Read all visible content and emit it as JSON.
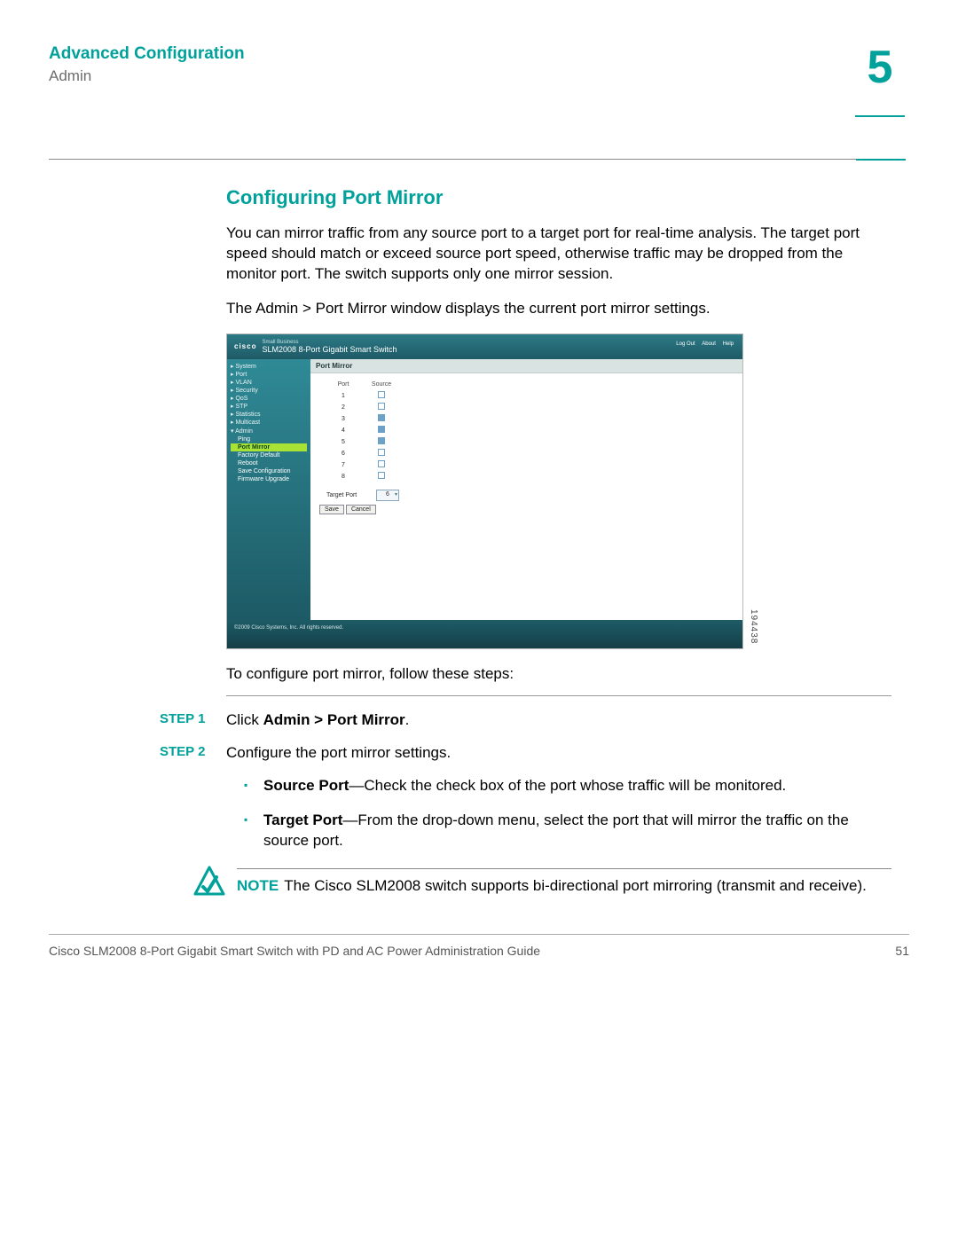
{
  "header": {
    "title": "Advanced Configuration",
    "breadcrumb": "Admin",
    "chapter_number": "5"
  },
  "section": {
    "title": "Configuring Port Mirror",
    "intro_1": "You can mirror traffic from any source port to a target port for real-time analysis. The target port speed should match or exceed source port speed, otherwise traffic may be dropped from the monitor port. The switch supports only one mirror session.",
    "intro_2": "The Admin > Port Mirror window displays the current port mirror settings."
  },
  "screenshot": {
    "logo": "cisco",
    "small_business": "Small Business",
    "product_name": "SLM2008 8-Port Gigabit Smart Switch",
    "top_links": [
      "Log Out",
      "About",
      "Help"
    ],
    "nav_items": [
      "▸ System",
      "▸ Port",
      "▸ VLAN",
      "▸ Security",
      "▸ QoS",
      "▸ STP",
      "▸ Statistics",
      "▸ Multicast"
    ],
    "nav_admin": "▾ Admin",
    "nav_sub_items_before": [
      "Ping"
    ],
    "nav_selected": "Port Mirror",
    "nav_sub_items_after": [
      "Factory Default",
      "Reboot",
      "Save Configuration",
      "Firmware Upgrade"
    ],
    "panel_title": "Port Mirror",
    "col_port": "Port",
    "col_source": "Source",
    "ports": [
      {
        "port": "1",
        "checked": false
      },
      {
        "port": "2",
        "checked": false
      },
      {
        "port": "3",
        "checked": true
      },
      {
        "port": "4",
        "checked": true
      },
      {
        "port": "5",
        "checked": true
      },
      {
        "port": "6",
        "checked": false
      },
      {
        "port": "7",
        "checked": false
      },
      {
        "port": "8",
        "checked": false
      }
    ],
    "target_port_label": "Target Port",
    "target_port_value": "6",
    "save_label": "Save",
    "cancel_label": "Cancel",
    "copyright": "©2009 Cisco Systems, Inc. All rights reserved.",
    "side_number": "194438"
  },
  "after_screenshot": "To configure port mirror, follow these steps:",
  "steps": {
    "s1_label": "STEP 1",
    "s1_prefix": "Click ",
    "s1_bold": "Admin > Port Mirror",
    "s1_suffix": ".",
    "s2_label": "STEP 2",
    "s2_text": "Configure the port mirror settings."
  },
  "bullets": {
    "b1_bold": "Source Port",
    "b1_text": "—Check the check box of the port whose traffic will be monitored.",
    "b2_bold": "Target Port",
    "b2_text": "—From the drop-down menu, select the port that will mirror the traffic on the source port."
  },
  "note": {
    "label": "NOTE",
    "text": "The Cisco SLM2008 switch supports bi-directional port mirroring (transmit and receive)."
  },
  "footer": {
    "doc_title": "Cisco SLM2008 8-Port Gigabit Smart Switch with PD and AC Power Administration Guide",
    "page_number": "51"
  }
}
